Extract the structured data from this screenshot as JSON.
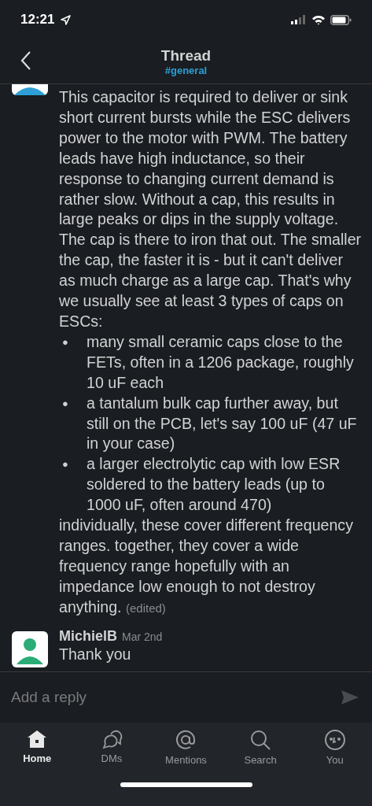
{
  "status_bar": {
    "time": "12:21"
  },
  "header": {
    "title": "Thread",
    "channel": "#general"
  },
  "messages": [
    {
      "kind": "continued",
      "intro": "This capacitor is required to deliver or sink short current bursts while the ESC delivers power to the motor with PWM. The battery leads have high inductance, so their response to changing current demand is rather slow. Without a cap, this results in large peaks or dips in the supply voltage. The cap is there to iron that out. The smaller the cap, the faster it is - but it can't deliver as much charge as a large cap. That's why we usually see at least 3 types of caps on ESCs:",
      "bullets": [
        {
          "mark": "●",
          "text": "many small ceramic caps close to the FETs, often in a 1206 package, roughly 10 uF each"
        },
        {
          "mark": "●",
          "text": "a tantalum bulk cap further away, but still on the PCB, let's say 100 uF (47 uF in your case)"
        },
        {
          "mark": "●",
          "text": "a larger electrolytic cap with low ESR soldered to the battery leads (up to 1000 uF, often around 470)"
        }
      ],
      "outro": "individually, these cover different frequency ranges. together, they cover a wide frequency range hopefully with an impedance low enough to not destroy anything.",
      "edited": "(edited)"
    },
    {
      "kind": "full",
      "author": "MichielB",
      "date": "Mar 2nd",
      "intro": "Thank you"
    }
  ],
  "composer": {
    "placeholder": "Add a reply"
  },
  "tabs": [
    {
      "label": "Home",
      "selected": true
    },
    {
      "label": "DMs",
      "selected": false
    },
    {
      "label": "Mentions",
      "selected": false
    },
    {
      "label": "Search",
      "selected": false
    },
    {
      "label": "You",
      "selected": false
    }
  ]
}
